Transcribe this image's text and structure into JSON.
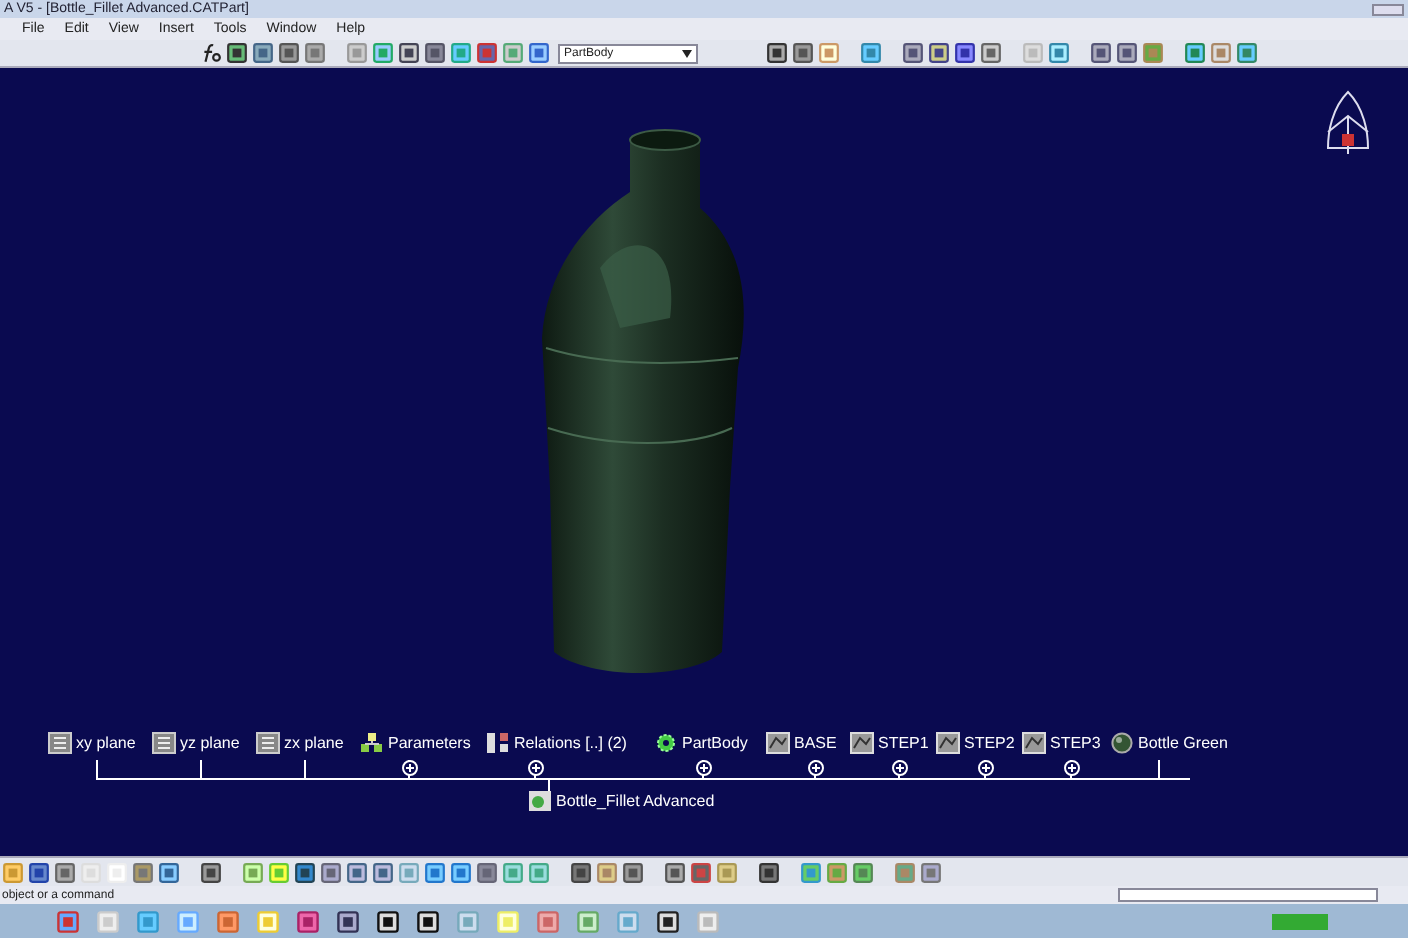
{
  "window": {
    "title": "A V5 - [Bottle_Fillet Advanced.CATPart]"
  },
  "menu": [
    "File",
    "Edit",
    "View",
    "Insert",
    "Tools",
    "Window",
    "Help"
  ],
  "toolbar": {
    "body_dropdown": "PartBody"
  },
  "tree": {
    "root": {
      "label": "Bottle_Fillet Advanced",
      "children": [
        {
          "label": "xy plane",
          "kind": "plane",
          "collapsed": false
        },
        {
          "label": "yz plane",
          "kind": "plane",
          "collapsed": false
        },
        {
          "label": "zx plane",
          "kind": "plane",
          "collapsed": false
        },
        {
          "label": "Parameters",
          "kind": "parameters",
          "collapsed": true
        },
        {
          "label": "Relations [..] (2)",
          "kind": "relations",
          "collapsed": true
        },
        {
          "label": "PartBody",
          "kind": "body",
          "collapsed": true
        },
        {
          "label": "BASE",
          "kind": "sketch",
          "collapsed": true
        },
        {
          "label": "STEP1",
          "kind": "sketch",
          "collapsed": true
        },
        {
          "label": "STEP2",
          "kind": "sketch",
          "collapsed": true
        },
        {
          "label": "STEP3",
          "kind": "sketch",
          "collapsed": true
        },
        {
          "label": "Bottle Green",
          "kind": "material",
          "collapsed": false
        }
      ]
    }
  },
  "status_bar": {
    "prompt": "object or a command"
  }
}
